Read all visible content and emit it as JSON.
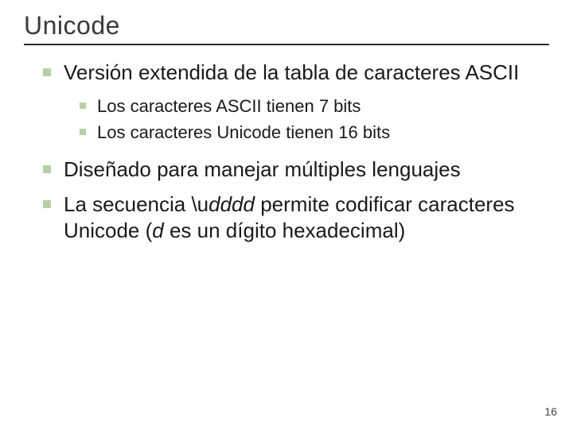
{
  "title": "Unicode",
  "bullets": [
    {
      "text": "Versión extendida de la tabla de caracteres ASCII"
    },
    {
      "text": "Diseñado para manejar múltiples lenguajes"
    }
  ],
  "sub": [
    {
      "text": "Los caracteres ASCII tienen 7 bits"
    },
    {
      "text": "Los caracteres Unicode tienen 16 bits"
    }
  ],
  "b3": {
    "lead": "La secuencia \\u",
    "it1": "dddd",
    "mid": " permite codificar caracteres Unicode (",
    "it2": "d",
    "tail": " es un dígito hexadecimal)"
  },
  "page": "16"
}
